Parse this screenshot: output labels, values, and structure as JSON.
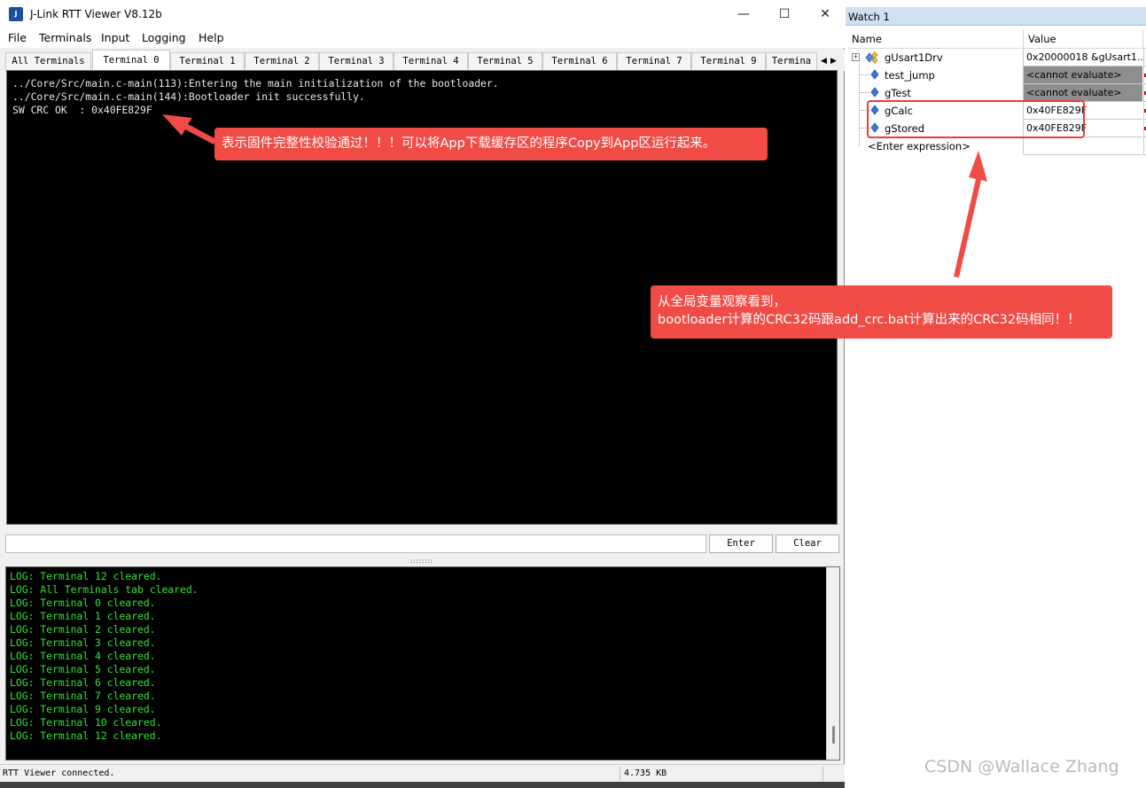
{
  "window": {
    "title": "J-Link RTT Viewer V8.12b",
    "icon_text": "J",
    "minimize_glyph": "—",
    "maximize_glyph": "☐",
    "close_glyph": "✕"
  },
  "menu": [
    "File",
    "Terminals",
    "Input",
    "Logging",
    "Help"
  ],
  "tabs": [
    "All Terminals",
    "Terminal 0",
    "Terminal 1",
    "Terminal 2",
    "Terminal 3",
    "Terminal 4",
    "Terminal 5",
    "Terminal 6",
    "Terminal 7",
    "Terminal 9",
    "Termina"
  ],
  "active_tab": "Terminal 0",
  "terminal_lines": [
    "../Core/Src/main.c-main(113):Entering the main initialization of the bootloader.",
    "../Core/Src/main.c-main(144):Bootloader init successfully.",
    "SW CRC OK  : 0x40FE829F"
  ],
  "input": {
    "value": "",
    "enter_label": "Enter",
    "clear_label": "Clear"
  },
  "log_lines": [
    "LOG: Terminal 12 cleared.",
    "LOG: All Terminals tab cleared.",
    "LOG: Terminal 0 cleared.",
    "LOG: Terminal 1 cleared.",
    "LOG: Terminal 2 cleared.",
    "LOG: Terminal 3 cleared.",
    "LOG: Terminal 4 cleared.",
    "LOG: Terminal 5 cleared.",
    "LOG: Terminal 6 cleared.",
    "LOG: Terminal 7 cleared.",
    "LOG: Terminal 9 cleared.",
    "LOG: Terminal 10 cleared.",
    "LOG: Terminal 12 cleared."
  ],
  "status": {
    "message": "RTT Viewer connected.",
    "data_size": "4.735 KB"
  },
  "watch": {
    "title": "Watch 1",
    "columns": {
      "name": "Name",
      "value": "Value"
    },
    "rows": [
      {
        "name": "gUsart1Drv",
        "value": "0x20000018 &gUsart1...",
        "kind": "struct"
      },
      {
        "name": "test_jump",
        "value": "<cannot evaluate>",
        "kind": "var"
      },
      {
        "name": "gTest",
        "value": "<cannot evaluate>",
        "kind": "var"
      },
      {
        "name": "gCalc",
        "value": "0x40FE829F",
        "kind": "var"
      },
      {
        "name": "gStored",
        "value": "0x40FE829F",
        "kind": "var"
      }
    ],
    "enter_expression": "<Enter expression>"
  },
  "annotations": {
    "callout_1": "表示固件完整性校验通过！！！可以将App下载缓存区的程序Copy到App区运行起来。",
    "callout_2_line1": "从全局变量观察看到，",
    "callout_2_line2": "bootloader计算的CRC32码跟add_crc.bat计算出来的CRC32码相同！！"
  },
  "watermark": "CSDN @Wallace Zhang",
  "colors": {
    "terminal_bg": "#000000",
    "terminal_text": "#e8e8e8",
    "log_text": "#31e231",
    "callout_bg": "#f14b46",
    "highlight_border": "#ee3a3a",
    "cannot_evaluate_bg": "#8e8e8e",
    "watch_title_bg": "#cfe0f3"
  }
}
